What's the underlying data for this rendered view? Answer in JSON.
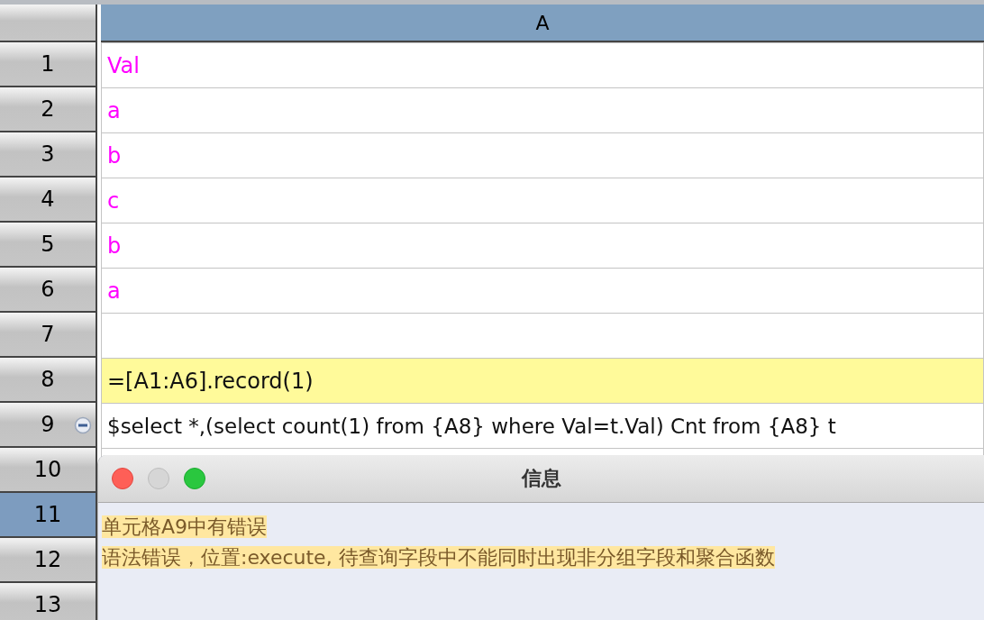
{
  "columns": [
    {
      "label": "A"
    }
  ],
  "rows": [
    {
      "number": "1",
      "value": "Val",
      "kind": "constant",
      "selected": false,
      "collapsible": false
    },
    {
      "number": "2",
      "value": "a",
      "kind": "constant",
      "selected": false,
      "collapsible": false
    },
    {
      "number": "3",
      "value": "b",
      "kind": "constant",
      "selected": false,
      "collapsible": false
    },
    {
      "number": "4",
      "value": "c",
      "kind": "constant",
      "selected": false,
      "collapsible": false
    },
    {
      "number": "5",
      "value": "b",
      "kind": "constant",
      "selected": false,
      "collapsible": false
    },
    {
      "number": "6",
      "value": "a",
      "kind": "constant",
      "selected": false,
      "collapsible": false
    },
    {
      "number": "7",
      "kind": "empty",
      "selected": false,
      "collapsible": false
    },
    {
      "number": "8",
      "value": "=[A1:A6].record(1)",
      "kind": "formula",
      "selected": false,
      "collapsible": false
    },
    {
      "number": "9",
      "value": "$select *,(select count(1) from {A8} where Val=t.Val) Cnt from {A8} t",
      "kind": "sql",
      "selected": false,
      "collapsible": true
    },
    {
      "number": "10",
      "kind": "empty",
      "selected": false,
      "collapsible": false
    },
    {
      "number": "11",
      "kind": "empty",
      "selected": true,
      "collapsible": false
    },
    {
      "number": "12",
      "kind": "empty",
      "selected": false,
      "collapsible": false
    },
    {
      "number": "13",
      "kind": "empty",
      "selected": false,
      "collapsible": false
    }
  ],
  "dialog": {
    "title": "信息",
    "lines": [
      "单元格A9中有错误",
      "语法错误，位置:execute, 待查询字段中不能同时出现非分组字段和聚合函数"
    ]
  }
}
